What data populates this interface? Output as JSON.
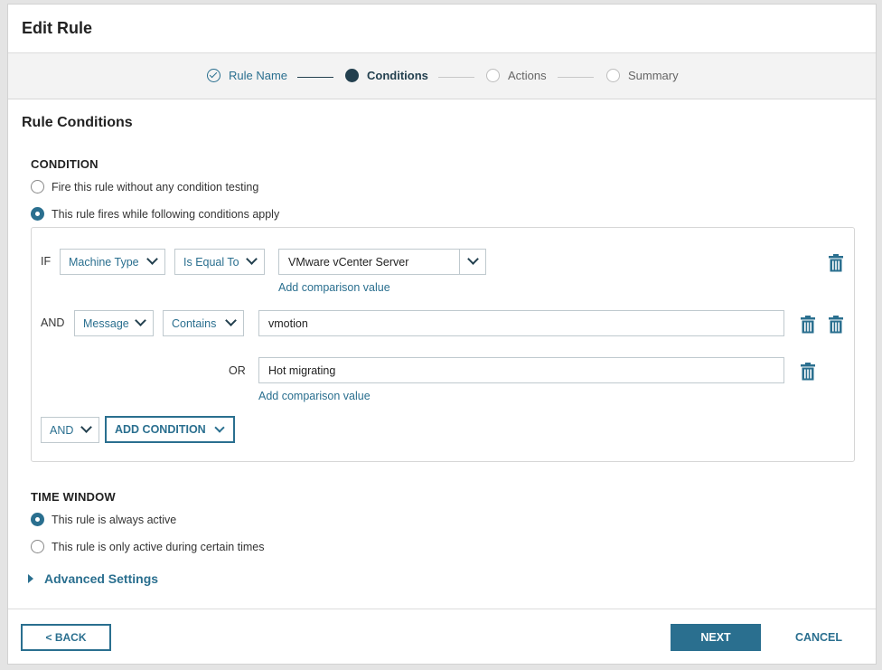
{
  "header": {
    "title": "Edit Rule"
  },
  "stepper": {
    "steps": [
      {
        "label": "Rule Name",
        "state": "done"
      },
      {
        "label": "Conditions",
        "state": "active"
      },
      {
        "label": "Actions",
        "state": "todo"
      },
      {
        "label": "Summary",
        "state": "todo"
      }
    ]
  },
  "section": {
    "title": "Rule Conditions"
  },
  "condition": {
    "heading": "CONDITION",
    "option_no_test": "Fire this rule without any condition testing",
    "option_conditions": "This rule fires while following conditions apply",
    "rows": {
      "if_keyword": "IF",
      "row1": {
        "field": "Machine Type",
        "operator": "Is Equal To",
        "value": "VMware vCenter Server",
        "add_value_link": "Add comparison value"
      },
      "and_keyword": "AND",
      "row2": {
        "field": "Message",
        "operator": "Contains",
        "value": "vmotion",
        "or_keyword": "OR",
        "or_value": "Hot migrating",
        "add_value_link": "Add comparison value"
      },
      "logic_select": "AND",
      "add_condition": "ADD CONDITION"
    }
  },
  "time_window": {
    "heading": "TIME WINDOW",
    "option_always": "This rule is always active",
    "option_certain": "This rule is only active during certain times"
  },
  "advanced": {
    "label": "Advanced Settings"
  },
  "footer": {
    "back": "< BACK",
    "next": "NEXT",
    "cancel": "CANCEL"
  },
  "colors": {
    "accent": "#2a6f8f",
    "dark": "#23404f"
  }
}
